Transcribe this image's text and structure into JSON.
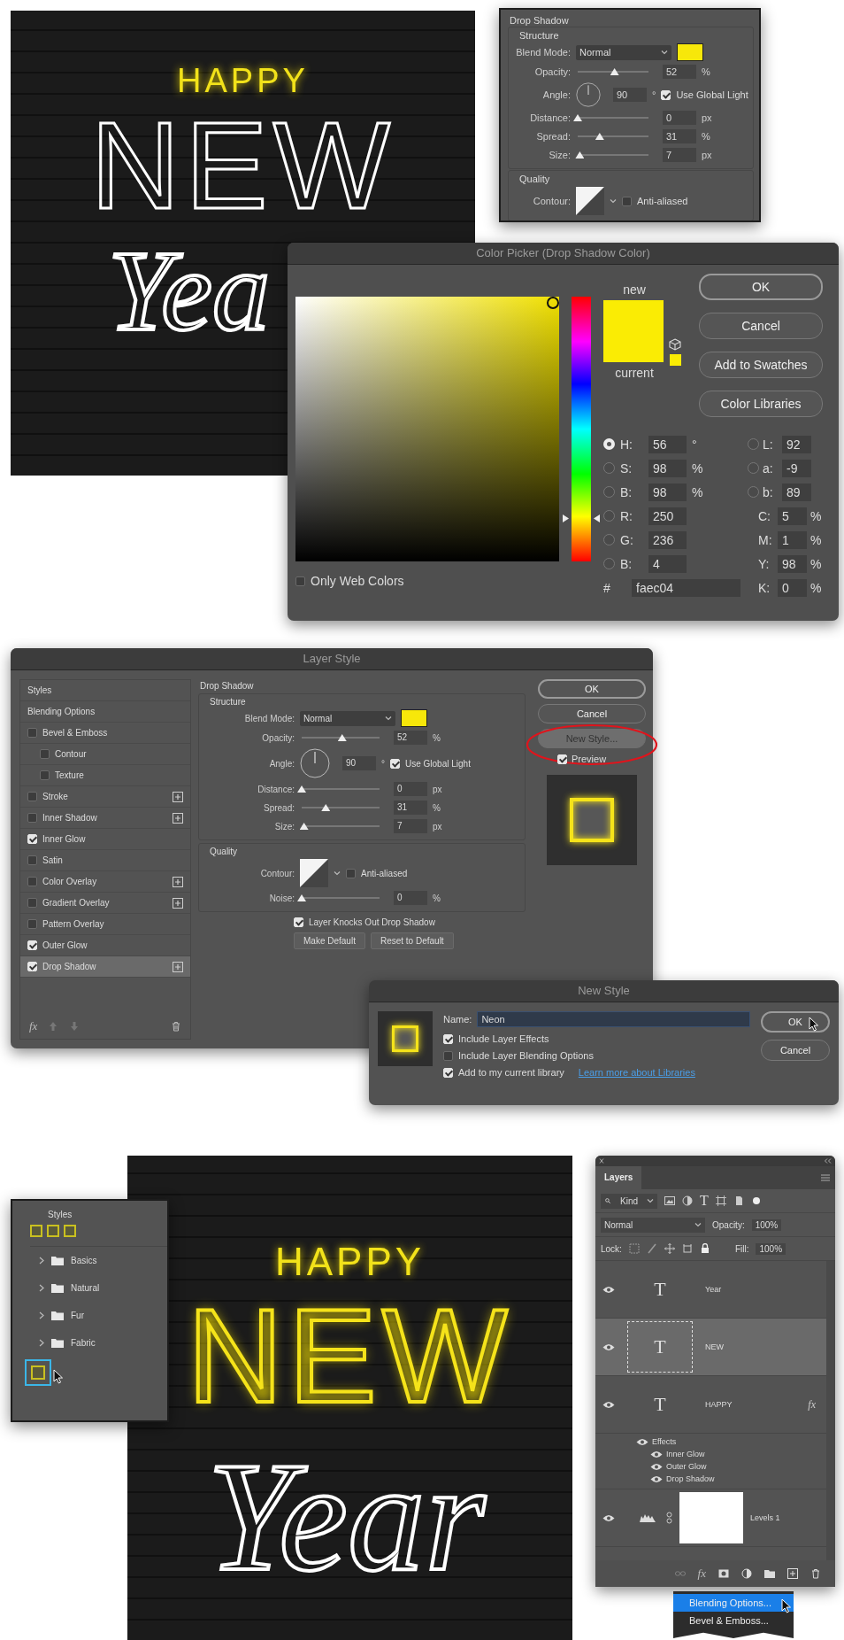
{
  "artwork_top": {
    "lines": [
      {
        "text": "HAPPY",
        "kind": "glow"
      },
      {
        "text": "NEW",
        "kind": "outline"
      },
      {
        "text": "Yea",
        "kind": "script"
      }
    ]
  },
  "drop_shadow_crop": {
    "title": "Drop Shadow",
    "sections": [
      {
        "heading": "Structure",
        "rows": [
          {
            "kind": "select",
            "label": "Blend Mode:",
            "value": "Normal"
          },
          {
            "kind": "slider",
            "label": "Opacity:",
            "level": 0.52,
            "value": "52",
            "unit": "%"
          },
          {
            "kind": "angle",
            "label": "Angle:",
            "value": "90",
            "unit": "°",
            "option": {
              "label": "Use Global Light",
              "checked": true
            }
          },
          {
            "kind": "slider",
            "label": "Distance:",
            "level": 0,
            "value": "0",
            "unit": "px"
          },
          {
            "kind": "slider",
            "label": "Spread:",
            "level": 0.31,
            "value": "31",
            "unit": "%"
          },
          {
            "kind": "slider",
            "label": "Size:",
            "level": 0.03,
            "value": "7",
            "unit": "px"
          }
        ]
      },
      {
        "heading": "Quality",
        "rows": [
          {
            "kind": "contour",
            "label": "Contour:",
            "option": {
              "label": "Anti-aliased",
              "checked": false
            }
          }
        ]
      }
    ]
  },
  "color_picker": {
    "title": "Color Picker (Drop Shadow Color)",
    "hue_slider": {
      "level": 0.16
    },
    "new_label": "new",
    "current_label": "current",
    "only_web_colors": {
      "label": "Only Web Colors",
      "checked": false
    },
    "buttons": [
      {
        "label": "OK",
        "kind": "default"
      },
      {
        "label": "Cancel",
        "kind": "normal"
      },
      {
        "label": "Add to Swatches",
        "kind": "normal"
      },
      {
        "label": "Color Libraries",
        "kind": "normal"
      }
    ],
    "left_fields": [
      {
        "kind": "radio",
        "label": "H:",
        "value": "56",
        "unit": "°",
        "selected": true
      },
      {
        "kind": "radio",
        "label": "S:",
        "value": "98",
        "unit": "%",
        "selected": false
      },
      {
        "kind": "radio",
        "label": "B:",
        "value": "98",
        "unit": "%",
        "selected": false
      },
      {
        "kind": "radio",
        "label": "R:",
        "value": "250",
        "selected": false
      },
      {
        "kind": "radio",
        "label": "G:",
        "value": "236",
        "selected": false
      },
      {
        "kind": "radio",
        "label": "B:",
        "value": "4",
        "selected": false
      }
    ],
    "right_fields": [
      {
        "kind": "radio",
        "label": "L:",
        "value": "92",
        "selected": false
      },
      {
        "kind": "radio",
        "label": "a:",
        "value": "-9",
        "selected": false
      },
      {
        "kind": "radio",
        "label": "b:",
        "value": "89",
        "selected": false
      },
      {
        "kind": "plain",
        "label": "C:",
        "value": "5",
        "unit": "%"
      },
      {
        "kind": "plain",
        "label": "M:",
        "value": "1",
        "unit": "%"
      },
      {
        "kind": "plain",
        "label": "Y:",
        "value": "98",
        "unit": "%"
      },
      {
        "kind": "plain",
        "label": "K:",
        "value": "0",
        "unit": "%"
      }
    ],
    "hex": {
      "label": "#",
      "value": "faec04"
    }
  },
  "layer_style": {
    "title": "Layer Style",
    "sidebar": [
      {
        "label": "Styles",
        "kind": "header",
        "selected": false
      },
      {
        "label": "Blending Options",
        "kind": "header",
        "selected": false
      },
      {
        "label": "Bevel & Emboss",
        "kind": "check",
        "checked": false,
        "selected": false,
        "children": [
          {
            "label": "Contour",
            "kind": "check",
            "checked": false,
            "selected": false
          },
          {
            "label": "Texture",
            "kind": "check",
            "checked": false,
            "selected": false
          }
        ]
      },
      {
        "label": "Stroke",
        "kind": "check",
        "checked": false,
        "add": true,
        "selected": false
      },
      {
        "label": "Inner Shadow",
        "kind": "check",
        "checked": false,
        "add": true,
        "selected": false
      },
      {
        "label": "Inner Glow",
        "kind": "check",
        "checked": true,
        "selected": false
      },
      {
        "label": "Satin",
        "kind": "check",
        "checked": false,
        "selected": false
      },
      {
        "label": "Color Overlay",
        "kind": "check",
        "checked": false,
        "add": true,
        "selected": false
      },
      {
        "label": "Gradient Overlay",
        "kind": "check",
        "checked": false,
        "add": true,
        "selected": false
      },
      {
        "label": "Pattern Overlay",
        "kind": "check",
        "checked": false,
        "selected": false
      },
      {
        "label": "Outer Glow",
        "kind": "check",
        "checked": true,
        "selected": false
      },
      {
        "label": "Drop Shadow",
        "kind": "check",
        "checked": true,
        "add": true,
        "selected": true
      }
    ],
    "footer_fx": "fx",
    "drop_shadow": {
      "title": "Drop Shadow",
      "sections": [
        {
          "heading": "Structure",
          "rows": [
            {
              "kind": "select",
              "label": "Blend Mode:",
              "value": "Normal"
            },
            {
              "kind": "slider",
              "label": "Opacity:",
              "level": 0.52,
              "value": "52",
              "unit": "%"
            },
            {
              "kind": "angle",
              "label": "Angle:",
              "value": "90",
              "unit": "°",
              "option": {
                "label": "Use Global Light",
                "checked": true
              }
            },
            {
              "kind": "slider",
              "label": "Distance:",
              "level": 0,
              "value": "0",
              "unit": "px"
            },
            {
              "kind": "slider",
              "label": "Spread:",
              "level": 0.31,
              "value": "31",
              "unit": "%"
            },
            {
              "kind": "slider",
              "label": "Size:",
              "level": 0.03,
              "value": "7",
              "unit": "px"
            }
          ]
        },
        {
          "heading": "Quality",
          "rows": [
            {
              "kind": "contour",
              "label": "Contour:",
              "option": {
                "label": "Anti-aliased",
                "checked": false
              }
            },
            {
              "kind": "slider",
              "label": "Noise:",
              "level": 0,
              "value": "0",
              "unit": "%"
            }
          ]
        }
      ]
    },
    "knockout": {
      "label": "Layer Knocks Out Drop Shadow",
      "checked": true
    },
    "center_buttons": [
      "Make Default",
      "Reset to Default"
    ],
    "buttons": [
      {
        "label": "OK",
        "kind": "default"
      },
      {
        "label": "Cancel",
        "kind": "normal"
      },
      {
        "label": "New Style...",
        "kind": "highlighted"
      }
    ],
    "preview": {
      "label": "Preview",
      "checked": true
    }
  },
  "new_style": {
    "title": "New Style",
    "name_label": "Name:",
    "name_value": "Neon",
    "options": [
      {
        "label": "Include Layer Effects",
        "checked": true
      },
      {
        "label": "Include Layer Blending Options",
        "checked": false
      },
      {
        "label": "Add to my current library",
        "checked": true,
        "link": "Learn more about Libraries"
      }
    ],
    "buttons": [
      {
        "label": "OK",
        "kind": "default"
      },
      {
        "label": "Cancel",
        "kind": "normal"
      }
    ]
  },
  "artwork_bottom": {
    "lines": [
      {
        "text": "HAPPY",
        "kind": "glow"
      },
      {
        "text": "NEW",
        "kind": "neon"
      },
      {
        "text": "Year",
        "kind": "script"
      }
    ]
  },
  "styles_panel": {
    "title": "Styles",
    "folders": [
      {
        "label": "Basics",
        "expanded": false
      },
      {
        "label": "Natural",
        "expanded": false
      },
      {
        "label": "Fur",
        "expanded": false
      },
      {
        "label": "Fabric",
        "expanded": false
      }
    ],
    "new_preset": {
      "selected": true
    }
  },
  "layers_panel": {
    "tab": "Layers",
    "filter": "Kind",
    "type_filter": "T",
    "blend_mode": "Normal",
    "opacity_label": "Opacity:",
    "opacity_value": "100%",
    "lock_label": "Lock:",
    "fill_label": "Fill:",
    "fill_value": "100%",
    "layers": [
      {
        "name": "Year",
        "kind": "text",
        "glyph": "T",
        "selected": false
      },
      {
        "name": "NEW",
        "kind": "text",
        "glyph": "T",
        "selected": true
      },
      {
        "name": "HAPPY",
        "kind": "text",
        "glyph": "T",
        "selected": false,
        "fx": "fx",
        "effects": {
          "label": "Effects",
          "children": [
            {
              "name": "Inner Glow"
            },
            {
              "name": "Outer Glow"
            },
            {
              "name": "Drop Shadow"
            }
          ]
        }
      },
      {
        "name": "Levels 1",
        "kind": "adjustment",
        "selected": false
      }
    ],
    "toolbar_fx": "fx",
    "menu": [
      {
        "label": "Blending Options...",
        "selected": true
      },
      {
        "label": "Bevel & Emboss...",
        "selected": false
      }
    ]
  }
}
